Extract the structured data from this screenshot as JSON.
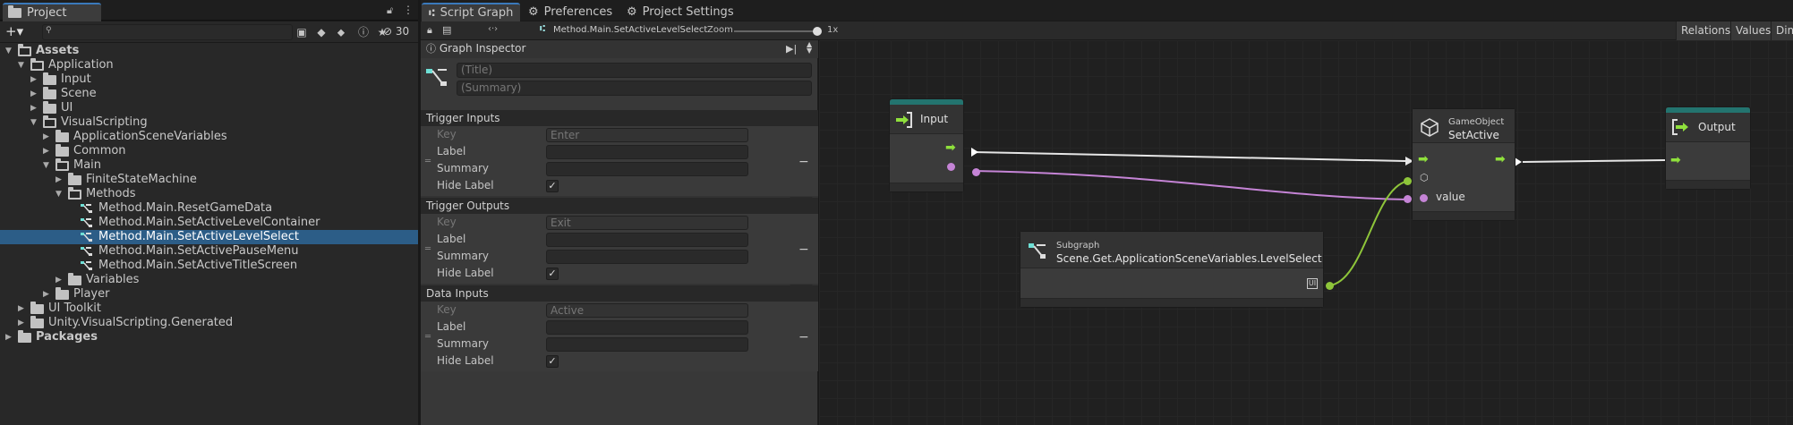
{
  "project": {
    "tab": "Project",
    "search_placeholder": "",
    "hidden_count": "30",
    "tree": [
      {
        "label": "Assets",
        "depth": 0,
        "kind": "folder-open",
        "expanded": true,
        "bold": true
      },
      {
        "label": "Application",
        "depth": 1,
        "kind": "folder-open",
        "expanded": true
      },
      {
        "label": "Input",
        "depth": 2,
        "kind": "folder",
        "expanded": false
      },
      {
        "label": "Scene",
        "depth": 2,
        "kind": "folder",
        "expanded": false
      },
      {
        "label": "UI",
        "depth": 2,
        "kind": "folder",
        "expanded": false
      },
      {
        "label": "VisualScripting",
        "depth": 2,
        "kind": "folder-open",
        "expanded": true
      },
      {
        "label": "ApplicationSceneVariables",
        "depth": 3,
        "kind": "folder",
        "expanded": false
      },
      {
        "label": "Common",
        "depth": 3,
        "kind": "folder",
        "expanded": false
      },
      {
        "label": "Main",
        "depth": 3,
        "kind": "folder-open",
        "expanded": true
      },
      {
        "label": "FiniteStateMachine",
        "depth": 4,
        "kind": "folder",
        "expanded": false
      },
      {
        "label": "Methods",
        "depth": 4,
        "kind": "folder-open",
        "expanded": true
      },
      {
        "label": "Method.Main.ResetGameData",
        "depth": 5,
        "kind": "graph"
      },
      {
        "label": "Method.Main.SetActiveLevelContainer",
        "depth": 5,
        "kind": "graph"
      },
      {
        "label": "Method.Main.SetActiveLevelSelect",
        "depth": 5,
        "kind": "graph",
        "selected": true
      },
      {
        "label": "Method.Main.SetActivePauseMenu",
        "depth": 5,
        "kind": "graph"
      },
      {
        "label": "Method.Main.SetActiveTitleScreen",
        "depth": 5,
        "kind": "graph"
      },
      {
        "label": "Variables",
        "depth": 4,
        "kind": "folder",
        "expanded": false
      },
      {
        "label": "Player",
        "depth": 3,
        "kind": "folder",
        "expanded": false
      },
      {
        "label": "UI Toolkit",
        "depth": 1,
        "kind": "folder",
        "expanded": false
      },
      {
        "label": "Unity.VisualScripting.Generated",
        "depth": 1,
        "kind": "folder",
        "expanded": false
      },
      {
        "label": "Packages",
        "depth": 0,
        "kind": "folder",
        "expanded": false,
        "bold": true
      }
    ]
  },
  "tabs": {
    "script_graph": "Script Graph",
    "preferences": "Preferences",
    "project_settings": "Project Settings"
  },
  "toolbar": {
    "breadcrumb": "Method.Main.SetActiveLevelSelect",
    "zoom_label": "Zoom",
    "zoom_value": "1x",
    "zoom_level": 1.0,
    "relations": "Relations",
    "values": "Values",
    "dim": "Dim"
  },
  "inspector": {
    "title": "Graph Inspector",
    "title_placeholder": "(Title)",
    "summary_placeholder": "(Summary)",
    "sections": [
      {
        "header": "Trigger Inputs",
        "key_placeholder": "Enter"
      },
      {
        "header": "Trigger Outputs",
        "key_placeholder": "Exit"
      },
      {
        "header": "Data Inputs",
        "key_placeholder": "Active"
      }
    ],
    "key_label": "Key",
    "label_label": "Label",
    "summary_label": "Summary",
    "hide_label": "Hide Label",
    "checked": "✓",
    "minus": "−",
    "plus": "+"
  },
  "nodes": {
    "input": {
      "title": "Input"
    },
    "setactive": {
      "category": "GameObject",
      "title": "SetActive",
      "value_port": "value"
    },
    "output": {
      "title": "Output"
    },
    "subgraph": {
      "category": "Subgraph",
      "title": "Scene.Get.ApplicationSceneVariables.LevelSelect"
    }
  },
  "colors": {
    "selection": "#2c5d87",
    "control_flow": "#8fe03c",
    "data_bool": "#c584d6",
    "data_gameobject": "#8ec53a",
    "node_teal": "#23746f",
    "edge_white": "#e6e6e6"
  }
}
